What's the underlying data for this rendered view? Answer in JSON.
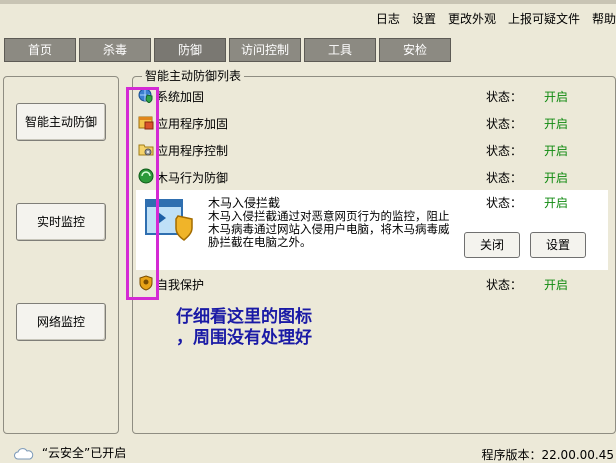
{
  "top_links": [
    "日志",
    "设置",
    "更改外观",
    "上报可疑文件",
    "帮助"
  ],
  "tabs": [
    {
      "label": "首页",
      "active": false
    },
    {
      "label": "杀毒",
      "active": false
    },
    {
      "label": "防御",
      "active": true
    },
    {
      "label": "访问控制",
      "active": false
    },
    {
      "label": "工具",
      "active": false
    },
    {
      "label": "安检",
      "active": false
    }
  ],
  "sidebar": {
    "items": [
      "智能主动防御",
      "实时监控",
      "网络监控"
    ]
  },
  "section_title": "智能主动防御列表",
  "status_label": "状态：",
  "rows": [
    {
      "label": "系统加固",
      "value": "开启",
      "icon": "shield-globe-icon"
    },
    {
      "label": "应用程序加固",
      "value": "开启",
      "icon": "app-window-icon"
    },
    {
      "label": "应用程序控制",
      "value": "开启",
      "icon": "folder-gear-icon"
    },
    {
      "label": "木马行为防御",
      "value": "开启",
      "icon": "green-orb-icon"
    }
  ],
  "expanded": {
    "title": "木马入侵拦截",
    "description": "木马入侵拦截通过对恶意网页行为的监控，阻止木马病毒通过网站入侵用户电脑，将木马病毒威胁拦截在电脑之外。",
    "value": "开启",
    "close_label": "关闭",
    "settings_label": "设置",
    "icon": "window-shield-icon"
  },
  "self_protect": {
    "label": "自我保护",
    "value": "开启",
    "icon": "lion-shield-icon"
  },
  "annotation": [
    "仔细看这里的图标",
    "，周围没有处理好"
  ],
  "status_bar": {
    "cloud_text": "“云安全”已开启",
    "version": "程序版本：22.00.00.45"
  },
  "colors": {
    "on_green": "#108a10",
    "annotation_blue": "#1a1aa6",
    "highlight_magenta": "#d42ad4"
  }
}
